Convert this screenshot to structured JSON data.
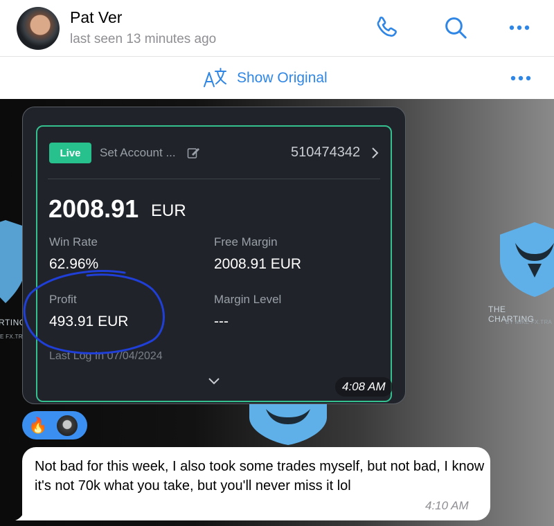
{
  "header": {
    "name": "Pat Ver",
    "status": "last seen 13 minutes ago",
    "icons": [
      "phone-icon",
      "search-icon",
      "more-icon"
    ]
  },
  "translate_bar": {
    "label": "Show Original",
    "icon": "translate-icon"
  },
  "photo_message": {
    "badge": "Live",
    "set_account": "Set Account ...",
    "account_number": "510474342",
    "balance": "2008.91",
    "balance_currency": "EUR",
    "win_rate_label": "Win Rate",
    "win_rate_value": "62.96%",
    "free_margin_label": "Free Margin",
    "free_margin_value": "2008.91 EUR",
    "profit_label": "Profit",
    "profit_value": "493.91 EUR",
    "margin_level_label": "Margin Level",
    "margin_level_value": "---",
    "last_log": "Last Log In 07/04/2024",
    "time": "4:08 AM",
    "annotation_color": "#1f3fd6",
    "accent_color": "#26c18c"
  },
  "watermark": {
    "title": "THE CHARTING",
    "subtitle": "BY MIKE FX.TRA",
    "left_title": "RTING",
    "left_subtitle": "E FX.TR",
    "logo_color": "#5fb0e8"
  },
  "reactions": {
    "emoji": "🔥",
    "background": "#3b8ff0"
  },
  "text_message": {
    "text": "Not bad for this week, I also took some trades myself, but not bad, I know it's not 70k what you take, but you'll never miss it lol",
    "time": "4:10 AM"
  }
}
